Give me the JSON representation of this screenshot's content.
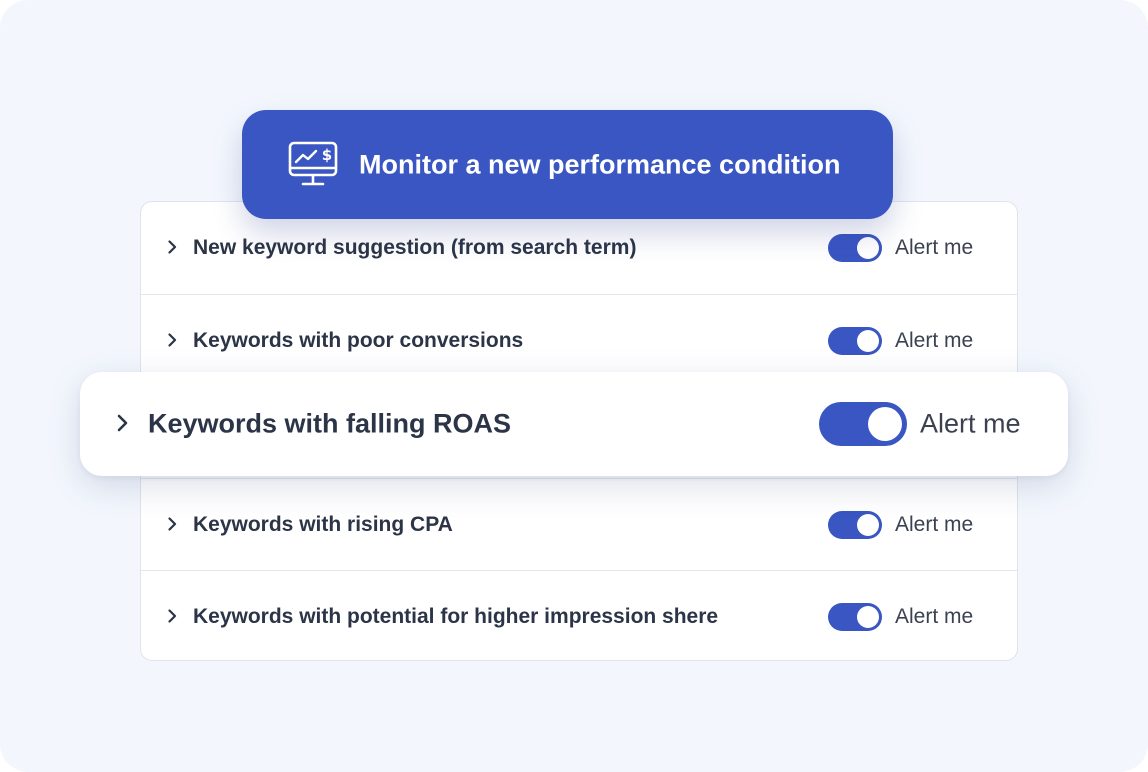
{
  "header_button": {
    "label": "Monitor a new performance condition",
    "icon": "monitor-dollar-icon"
  },
  "conditions": [
    {
      "label": "New keyword suggestion (from search term)",
      "toggle_on": true,
      "toggle_label": "Alert me"
    },
    {
      "label": "Keywords with poor conversions",
      "toggle_on": true,
      "toggle_label": "Alert me"
    },
    {
      "label": "Keywords with falling ROAS",
      "toggle_on": true,
      "toggle_label": "Alert me",
      "highlighted": true
    },
    {
      "label": "Keywords with rising CPA",
      "toggle_on": true,
      "toggle_label": "Alert me"
    },
    {
      "label": "Keywords with potential for higher impression shere",
      "toggle_on": true,
      "toggle_label": "Alert me"
    }
  ],
  "colors": {
    "accent": "#3a56c2",
    "background": "#f3f7fd",
    "text": "#2c3547"
  }
}
